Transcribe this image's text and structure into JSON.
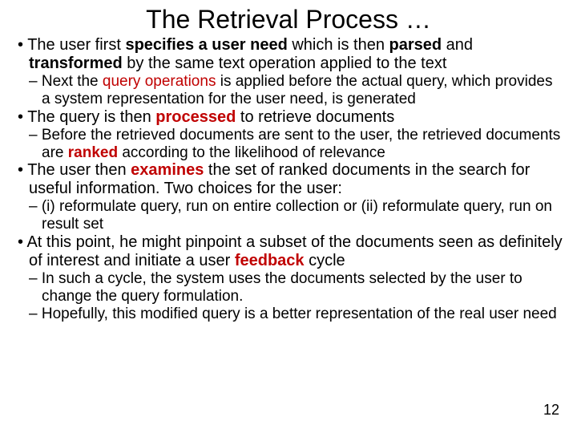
{
  "title": "The Retrieval Process …",
  "bullets": [
    {
      "level": 1,
      "runs": [
        {
          "t": "The user first "
        },
        {
          "t": "specifies a user need",
          "bold": true
        },
        {
          "t": " which is then "
        },
        {
          "t": "parsed",
          "bold": true
        },
        {
          "t": " and "
        },
        {
          "t": "transformed",
          "bold": true
        },
        {
          "t": " by the same text operation applied to the text"
        }
      ]
    },
    {
      "level": 2,
      "runs": [
        {
          "t": "Next the "
        },
        {
          "t": "query operations",
          "red": true
        },
        {
          "t": " is applied before the actual query, which provides a system representation for the user need, is generated"
        }
      ]
    },
    {
      "level": 1,
      "runs": [
        {
          "t": "The query is then "
        },
        {
          "t": "processed",
          "bold": true,
          "red": true
        },
        {
          "t": " to retrieve documents"
        }
      ]
    },
    {
      "level": 2,
      "runs": [
        {
          "t": "Before the retrieved documents are sent to the user, the retrieved documents are "
        },
        {
          "t": "ranked",
          "bold": true,
          "red": true
        },
        {
          "t": " according to the likelihood of relevance"
        }
      ]
    },
    {
      "level": 1,
      "runs": [
        {
          "t": "The user then "
        },
        {
          "t": "examines",
          "bold": true,
          "red": true
        },
        {
          "t": " the set of ranked documents in the search for useful information. Two choices for the user:"
        }
      ]
    },
    {
      "level": 2,
      "runs": [
        {
          "t": "(i) reformulate query, run on entire collection or (ii) reformulate query, run on result set"
        }
      ]
    },
    {
      "level": 1,
      "runs": [
        {
          "t": "At this point, he might pinpoint a subset of the documents seen as definitely of interest and initiate a user "
        },
        {
          "t": "feedback",
          "bold": true,
          "red": true
        },
        {
          "t": " cycle"
        }
      ]
    },
    {
      "level": 2,
      "runs": [
        {
          "t": "In such a cycle, the system uses the documents selected by the user to change the query formulation."
        }
      ]
    },
    {
      "level": 2,
      "runs": [
        {
          "t": "Hopefully, this modified query is a better representation of the real user need"
        }
      ]
    }
  ],
  "page_number": "12"
}
